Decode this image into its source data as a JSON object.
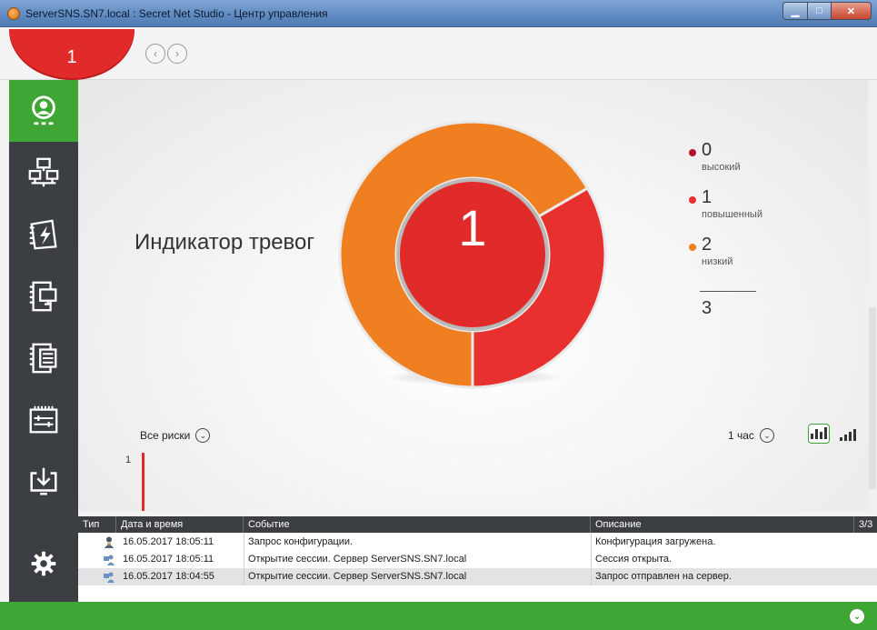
{
  "window": {
    "title": "ServerSNS.SN7.local : Secret Net Studio - Центр управления",
    "controls": {
      "minimize": "▁",
      "maximize": "□",
      "close": "✕"
    }
  },
  "topbar": {
    "alert_count": "1",
    "back_glyph": "‹",
    "forward_glyph": "›"
  },
  "sidebar": {
    "items": [
      {
        "name": "alerts",
        "icon": "radar-user-icon",
        "active": true
      },
      {
        "name": "network",
        "icon": "network-icon",
        "active": false
      },
      {
        "name": "policies",
        "icon": "policy-icon",
        "active": false
      },
      {
        "name": "computers",
        "icon": "computer-book-icon",
        "active": false
      },
      {
        "name": "journals",
        "icon": "journal-icon",
        "active": false
      },
      {
        "name": "hardware",
        "icon": "hardware-icon",
        "active": false
      },
      {
        "name": "import",
        "icon": "download-icon",
        "active": false
      },
      {
        "name": "settings",
        "icon": "gear-icon",
        "active": false
      }
    ]
  },
  "main": {
    "title": "Индикатор тревог",
    "center_count": "1",
    "risk_filter": "Все риски",
    "period_filter": "1 час",
    "chevron": "⌄",
    "mini_chart_y": "1"
  },
  "legend": {
    "items": [
      {
        "value": "0",
        "label": "высокий",
        "color": "#b3122a"
      },
      {
        "value": "1",
        "label": "повышенный",
        "color": "#e8302e"
      },
      {
        "value": "2",
        "label": "низкий",
        "color": "#f07f22"
      }
    ],
    "total": "3"
  },
  "colors": {
    "accent": "#3fa535",
    "sidebar": "#3b3e43",
    "danger": "#e12a2a",
    "warning": "#f07f22"
  },
  "table": {
    "headers": [
      "Тип",
      "Дата и время",
      "Событие",
      "Описание",
      "3/3"
    ],
    "rows": [
      {
        "icon": "user-icon",
        "datetime": "16.05.2017 18:05:11",
        "event": "Запрос конфигурации.",
        "description": "Конфигурация загружена."
      },
      {
        "icon": "network-user-icon",
        "datetime": "16.05.2017 18:05:11",
        "event": "Открытие сессии. Сервер ServerSNS.SN7.local",
        "description": "Сессия открыта."
      },
      {
        "icon": "network-user-icon",
        "datetime": "16.05.2017 18:04:55",
        "event": "Открытие сессии. Сервер ServerSNS.SN7.local",
        "description": "Запрос отправлен на сервер."
      }
    ]
  }
}
